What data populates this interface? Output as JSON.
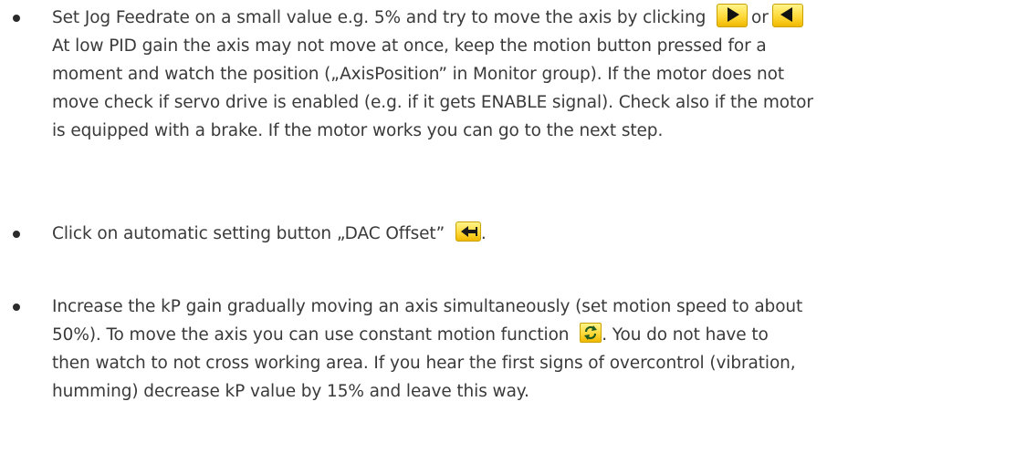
{
  "items": [
    {
      "lines": [
        "Set Jog Feedrate on a small value e.g. 5% and try to move the axis by clicking",
        "or",
        "At low PID gain the axis may not move at once, keep the motion button pressed for a",
        "moment and watch the position („AxisPosition” in Monitor group). If the motor does not",
        "move check if servo drive is enabled (e.g. if it gets ENABLE signal). Check also if the motor",
        "is equipped with a brake. If the motor works you can go to the next step."
      ],
      "icons": [
        "arrow-right-icon",
        "arrow-left-icon"
      ]
    },
    {
      "lines": [
        "Click on automatic setting button „DAC Offset”",
        "."
      ],
      "icons": [
        "dac-offset-icon"
      ]
    },
    {
      "lines": [
        "Increase the kP gain gradually moving an axis simultaneously (set motion speed  to about",
        "50%). To move the axis you can use constant motion function",
        ". You do not have to",
        "then watch to not cross working area. If you hear the first signs of overcontrol (vibration,",
        "humming) decrease kP value by 15% and leave this way."
      ],
      "icons": [
        "constant-motion-icon"
      ]
    }
  ],
  "colors": {
    "text": "#3a3a3a",
    "icon_fill": "#ffd93a",
    "icon_border": "#c9a100"
  }
}
